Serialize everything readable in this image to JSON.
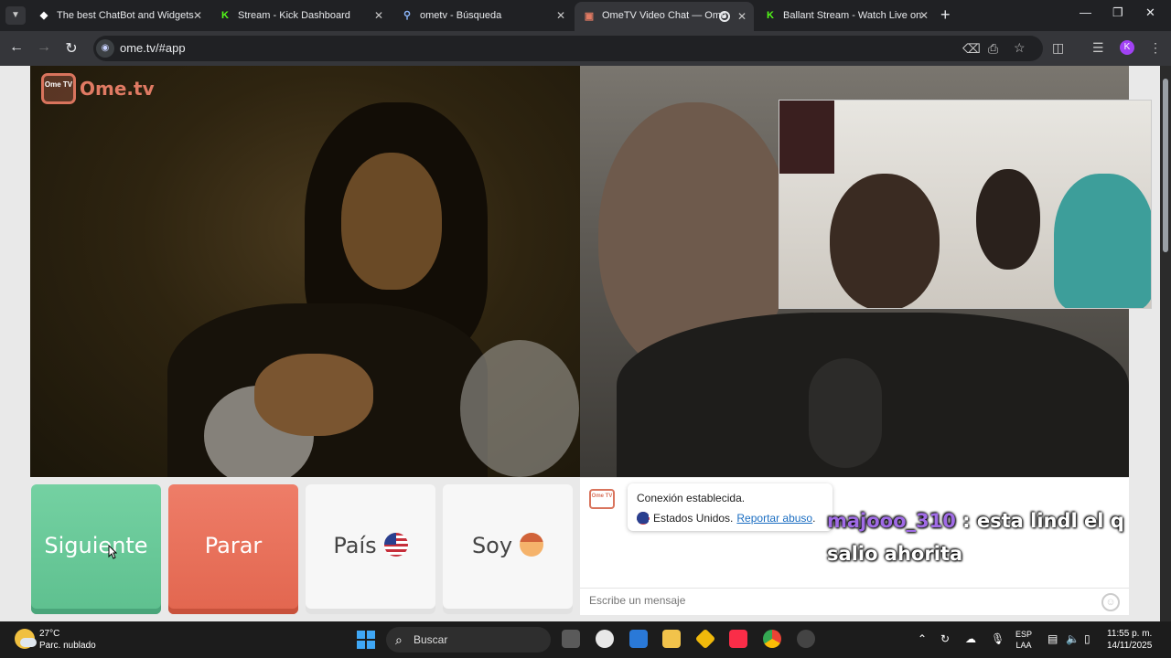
{
  "tabs": [
    {
      "title": "The best ChatBot and Widgets",
      "favicon": "diamond-icon"
    },
    {
      "title": "Stream - Kick Dashboard",
      "favicon": "kick-icon"
    },
    {
      "title": "ometv - Búsqueda",
      "favicon": "search-icon"
    },
    {
      "title": "OmeTV Video Chat — Ome",
      "favicon": "ometv-icon",
      "active": true
    },
    {
      "title": "Ballant Stream - Watch Live on",
      "favicon": "kick-icon"
    }
  ],
  "address": {
    "url": "ome.tv/#app"
  },
  "logo": {
    "badge": "Ome TV",
    "text": "Ome.tv"
  },
  "buttons": {
    "next": "Siguiente",
    "stop": "Parar",
    "country": "País",
    "gender": "Soy"
  },
  "chat": {
    "logo": "Ome TV",
    "system_line1": "Conexión establecida.",
    "system_country": "Estados Unidos.",
    "report_link": "Reportar abuso",
    "report_dot": ".",
    "input_placeholder": "Escribe un mensaje"
  },
  "overlay": {
    "user": "majooo_310",
    "message": " : esta lindl el q salio ahorita"
  },
  "taskbar": {
    "temp": "27°C",
    "weather": "Parc. nublado",
    "search": "Buscar",
    "lang1": "ESP",
    "lang2": "LAA",
    "time": "11:55 p. m.",
    "date": "14/11/2025"
  },
  "colors": {
    "next": "#5ec08f",
    "stop": "#e2664f",
    "username": "#a06be6",
    "link": "#1b6ec2"
  }
}
